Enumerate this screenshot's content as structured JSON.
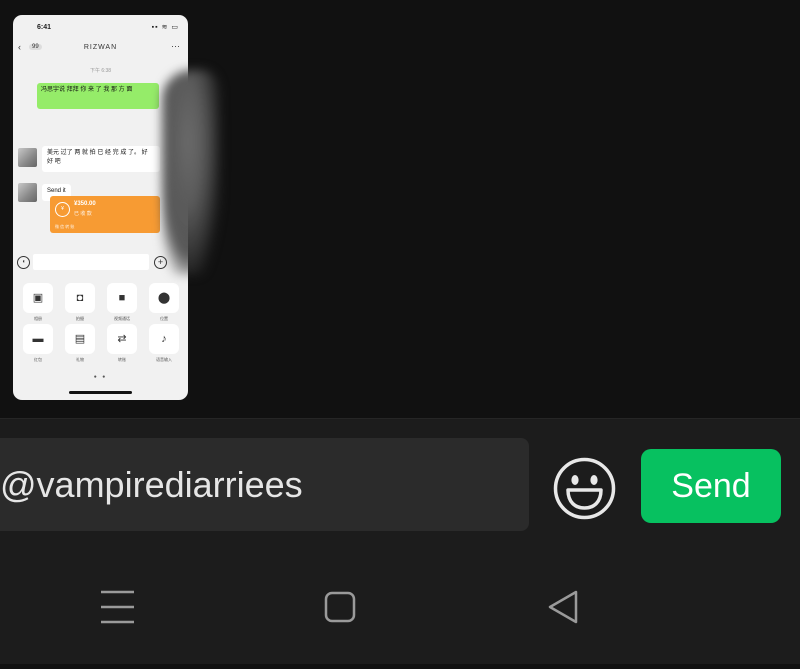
{
  "screenshot": {
    "status_time": "6:41",
    "status_icons": "▪▪ ≋ ▭",
    "back_icon": "chevron-left-icon",
    "unread_badge": "99",
    "contact_name": "RIZWAN",
    "more_icon": "more-icon",
    "timestamp_1": "下午 6:38",
    "sent_message": "冯思宇说 拜拜 你 来 了 我 那 方 面",
    "timestamp_2": "",
    "reply_1": "美元 过了 两 就 拍 已 经 完 成 了。 好 好 吧",
    "reply_2": "Send it",
    "transfer": {
      "amount": "¥350.00",
      "subtitle": "已 收 款",
      "footer": "微 信 转 账"
    },
    "actions": [
      {
        "icon": "photo-icon",
        "glyph": "▣",
        "label": "相册"
      },
      {
        "icon": "camera-icon",
        "glyph": "◘",
        "label": "拍摄"
      },
      {
        "icon": "video-call-icon",
        "glyph": "■",
        "label": "视频通话"
      },
      {
        "icon": "location-icon",
        "glyph": "⬤",
        "label": "位置"
      },
      {
        "icon": "red-packet-icon",
        "glyph": "▬",
        "label": "红包"
      },
      {
        "icon": "gift-icon",
        "glyph": "▤",
        "label": "礼物"
      },
      {
        "icon": "transfer-icon",
        "glyph": "⇄",
        "label": "转账"
      },
      {
        "icon": "voice-input-icon",
        "glyph": "♪",
        "label": "语音输入"
      }
    ],
    "page_dots": "● ●"
  },
  "composer": {
    "input_value": "@vampirediarriees",
    "emoji_icon": "emoji-smile-icon",
    "send_label": "Send",
    "send_color": "#07c160"
  },
  "system_nav": {
    "recents_icon": "menu-lines-icon",
    "home_icon": "home-square-icon",
    "back_icon": "back-triangle-icon"
  }
}
